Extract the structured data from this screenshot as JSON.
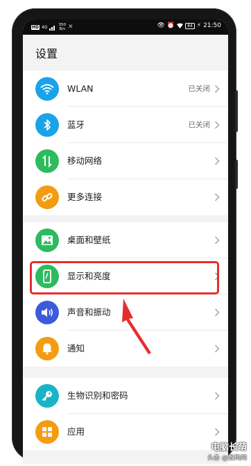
{
  "status_bar": {
    "hd": "HD",
    "signal": "4G",
    "net_speed_value": "350",
    "net_speed_unit": "B/s",
    "battery": "84",
    "time": "21:50"
  },
  "page_title": "设置",
  "groups": [
    {
      "items": [
        {
          "label": "WLAN",
          "value": "已关闭",
          "icon": "wifi-icon",
          "color": "#1aa3e8"
        },
        {
          "label": "蓝牙",
          "value": "已关闭",
          "icon": "bluetooth-icon",
          "color": "#1aa3e8"
        },
        {
          "label": "移动网络",
          "value": "",
          "icon": "mobile-data-icon",
          "color": "#2dbb5d"
        },
        {
          "label": "更多连接",
          "value": "",
          "icon": "link-icon",
          "color": "#f39c12"
        }
      ]
    },
    {
      "items": [
        {
          "label": "桌面和壁纸",
          "value": "",
          "icon": "wallpaper-icon",
          "color": "#2dbb5d"
        },
        {
          "label": "显示和亮度",
          "value": "",
          "icon": "display-icon",
          "color": "#2dbb5d"
        },
        {
          "label": "声音和振动",
          "value": "",
          "icon": "sound-icon",
          "color": "#3b5bdb"
        },
        {
          "label": "通知",
          "value": "",
          "icon": "bell-icon",
          "color": "#f39c12"
        }
      ]
    },
    {
      "items": [
        {
          "label": "生物识别和密码",
          "value": "",
          "icon": "key-icon",
          "color": "#19b3c7"
        },
        {
          "label": "应用",
          "value": "",
          "icon": "apps-icon",
          "color": "#f39c12"
        }
      ]
    }
  ],
  "highlight_color": "#e52e2e",
  "watermark": {
    "line1": "电脑长萌",
    "line2": "头条 @数码网"
  }
}
